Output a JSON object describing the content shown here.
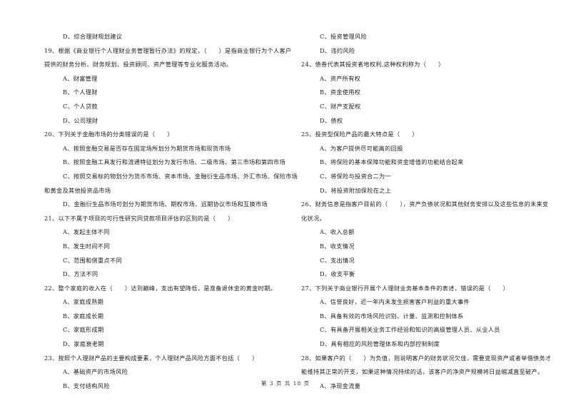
{
  "left_column": [
    {
      "type": "opt",
      "text": "D、综合理财规划建议"
    },
    {
      "type": "q",
      "text": "19、根据《商业银行个人理财业务管理暂行办法》的规定，（　　）是指商业银行为个人客户"
    },
    {
      "type": "cont",
      "text": "提供的财务分析、财务规划、投资顾问、资产管理等专业化服务活动。"
    },
    {
      "type": "opt",
      "text": "A、财富管理"
    },
    {
      "type": "opt",
      "text": "B、个人理财"
    },
    {
      "type": "opt",
      "text": "C、个人贷款"
    },
    {
      "type": "opt",
      "text": "D、公司理财"
    },
    {
      "type": "q",
      "text": "20、下列关于金融市场的分类错误的是（　　）"
    },
    {
      "type": "opt",
      "text": "A、按照金融交易是否存在固定场所划分为期货市场和现货市场"
    },
    {
      "type": "opt",
      "text": "B、按照金融工具发行和流通特征划分为发行市场、二级市场、第三市场和第四市场"
    },
    {
      "type": "opt",
      "text": "C、按照交易标的物划分为货币市场、资本市场、金融衍生品市场、外汇市场、保险市场"
    },
    {
      "type": "cont",
      "text": "和黄金及其他投资品市场"
    },
    {
      "type": "opt",
      "text": "D、金融衍生品市场可划分为期货市场、期权市场、远期协议市场和互换市场"
    },
    {
      "type": "q",
      "text": "21、以下不属于项目的可行性研究同贷款项目评估的区别的是（　　）"
    },
    {
      "type": "opt",
      "text": "A、发起主体不同"
    },
    {
      "type": "opt",
      "text": "B、发生时间不同"
    },
    {
      "type": "opt",
      "text": "C、范围和侧重点不同"
    },
    {
      "type": "opt",
      "text": "D、方法不同"
    },
    {
      "type": "q",
      "text": "22、整个家庭的收入在（　　）达到巅峰，支出有望降低，是准备退休金的黄金时期。"
    },
    {
      "type": "opt",
      "text": "A、家庭成熟期"
    },
    {
      "type": "opt",
      "text": "B、家庭成长期"
    },
    {
      "type": "opt",
      "text": "C、家庭形成期"
    },
    {
      "type": "opt",
      "text": "D、家庭衰老期"
    },
    {
      "type": "q",
      "text": "23、按照个人理财产品的主要构成要素，个人理财产品风险方面不包括（　　）"
    },
    {
      "type": "opt",
      "text": "A、基础资产的市场风险"
    },
    {
      "type": "opt",
      "text": "B、支付结构风险"
    }
  ],
  "right_column": [
    {
      "type": "opt",
      "text": "C、投资管理风险"
    },
    {
      "type": "opt",
      "text": "D、违约风险"
    },
    {
      "type": "q",
      "text": "24、债券代表其投资者地权利,这种权利称为（　　）"
    },
    {
      "type": "opt",
      "text": "A、资产所有权"
    },
    {
      "type": "opt",
      "text": "B、资金使用权"
    },
    {
      "type": "opt",
      "text": "C、财产支配权"
    },
    {
      "type": "opt",
      "text": "D、债权"
    },
    {
      "type": "q",
      "text": "25、投资型保险产品的最大特点是（　　）"
    },
    {
      "type": "opt",
      "text": "A、为客户提供尽可能高的回报"
    },
    {
      "type": "opt",
      "text": "B、将保险的基本保障功能和资金增值的功能结合起来"
    },
    {
      "type": "opt",
      "text": "C、将保险与投资合二为一"
    },
    {
      "type": "opt",
      "text": "D、将投资附加保险在之上"
    },
    {
      "type": "q",
      "text": "26、财务信息是指客户目前的（　　），资产负债状况和其他财务安排以及这些信息的未来变"
    },
    {
      "type": "cont",
      "text": "化状况。"
    },
    {
      "type": "opt",
      "text": "A、收入总额"
    },
    {
      "type": "opt",
      "text": "B、收支情况"
    },
    {
      "type": "opt",
      "text": "C、支出情况"
    },
    {
      "type": "opt",
      "text": "D、收支平衡"
    },
    {
      "type": "q",
      "text": "27、下列关于商业银行开展个人理财业务基本条件的表述，错误的是（　　）"
    },
    {
      "type": "opt",
      "text": "A、信誉良好，近一年内未发生损害客户利益的重大事件"
    },
    {
      "type": "opt",
      "text": "B、具备有效的市场风险识别、计量、监测和控制体系"
    },
    {
      "type": "opt",
      "text": "C、有具备开展相关业务工作经验和知识的高级管理人员、从业人员"
    },
    {
      "type": "opt",
      "text": "D、具有相应的风险管理体系和内部控制制度"
    },
    {
      "type": "q",
      "text": "28、如果客户的（　　）为负值，则说明客户的财务状况欠佳，需要变现资产或者举借债务才"
    },
    {
      "type": "cont",
      "text": "能维持其正常的开支，如果这种情况持续的话，该客户的净资产规模将日益缩减直至破产。"
    },
    {
      "type": "opt",
      "text": "A、净现金流量"
    }
  ],
  "footer": {
    "page_label": "第 3 页 共 18 页"
  }
}
